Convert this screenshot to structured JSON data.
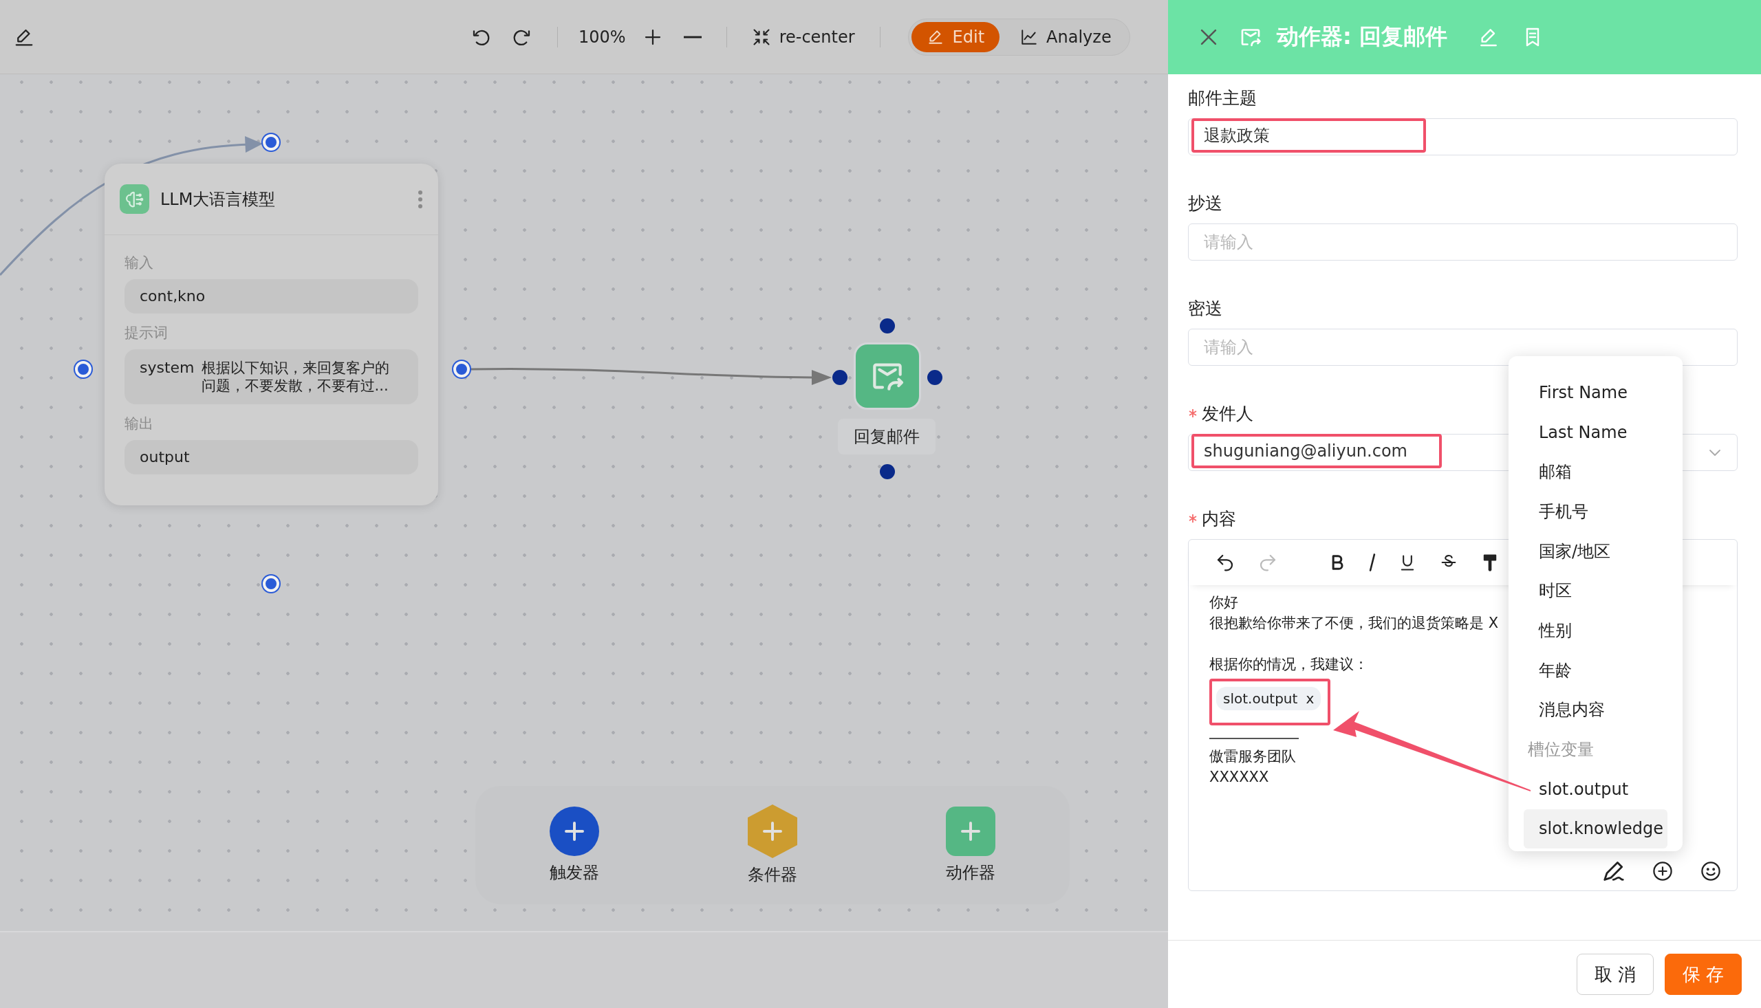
{
  "toolbar": {
    "zoom": "100%",
    "recenter": "re-center",
    "modes": [
      {
        "kind": "edit",
        "label": "Edit",
        "selected": true
      },
      {
        "kind": "analyze",
        "label": "Analyze",
        "selected": false
      }
    ]
  },
  "canvas": {
    "llm_node": {
      "title": "LLM大语言模型",
      "sections": [
        {
          "label": "输入",
          "value": "cont,kno"
        },
        {
          "label": "提示词",
          "role": "system",
          "value": "根据以下知识，来回复客户的问题，不要发散，不要有过..."
        },
        {
          "label": "输出",
          "value": "output"
        }
      ]
    },
    "action_node": {
      "label": "回复邮件"
    },
    "palette": [
      {
        "kind": "trigger",
        "label": "触发器"
      },
      {
        "kind": "condition",
        "label": "条件器"
      },
      {
        "kind": "action",
        "label": "动作器"
      }
    ]
  },
  "panel": {
    "title": "动作器: 回复邮件",
    "fields": [
      {
        "kind": "input",
        "label": "邮件主题",
        "value": "退款政策",
        "required": false,
        "highlighted": true
      },
      {
        "kind": "input",
        "label": "抄送",
        "placeholder": "请输入",
        "required": false
      },
      {
        "kind": "input",
        "label": "密送",
        "placeholder": "请输入",
        "required": false
      },
      {
        "kind": "select",
        "label": "发件人",
        "value": "shuguniang@aliyun.com",
        "required": true,
        "highlighted": true
      }
    ],
    "content": {
      "label": "内容",
      "required": true,
      "lines": [
        {
          "kind": "text",
          "text": "你好"
        },
        {
          "kind": "text",
          "text": "很抱歉给你带来了不便，我们的退货策略是 X"
        },
        {
          "kind": "blank"
        },
        {
          "kind": "text",
          "text": "根据你的情况，我建议："
        },
        {
          "kind": "chip",
          "text": "slot.output",
          "remove": "x",
          "highlighted": true
        },
        {
          "kind": "rule"
        },
        {
          "kind": "text",
          "text": "傲雷服务团队"
        },
        {
          "kind": "text",
          "text": "XXXXXX"
        }
      ]
    },
    "dropdown": [
      {
        "kind": "option",
        "label": "First Name",
        "selected": false
      },
      {
        "kind": "option",
        "label": "Last Name",
        "selected": false
      },
      {
        "kind": "option",
        "label": "邮箱",
        "selected": false
      },
      {
        "kind": "option",
        "label": "手机号",
        "selected": false
      },
      {
        "kind": "option",
        "label": "国家/地区",
        "selected": false
      },
      {
        "kind": "option",
        "label": "时区",
        "selected": false
      },
      {
        "kind": "option",
        "label": "性别",
        "selected": false
      },
      {
        "kind": "option",
        "label": "年龄",
        "selected": false
      },
      {
        "kind": "option",
        "label": "消息内容",
        "selected": false
      },
      {
        "kind": "group",
        "label": "槽位变量"
      },
      {
        "kind": "option",
        "label": "slot.output",
        "selected": false
      },
      {
        "kind": "option",
        "label": "slot.knowledge",
        "selected": true
      }
    ],
    "buttons": [
      {
        "kind": "secondary",
        "label": "取 消"
      },
      {
        "kind": "primary",
        "label": "保 存"
      }
    ]
  }
}
